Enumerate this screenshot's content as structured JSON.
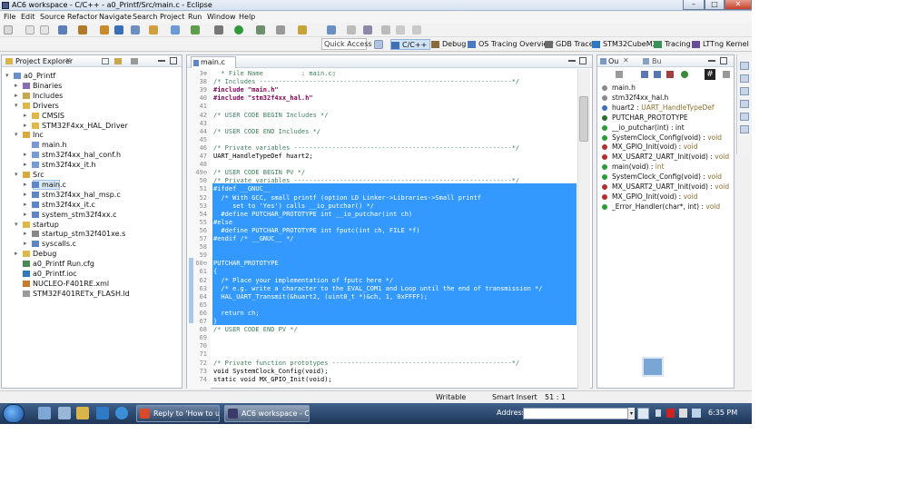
{
  "window": {
    "title": "AC6 workspace - C/C++ - a0_Printf/Src/main.c - Eclipse"
  },
  "menu": [
    "File",
    "Edit",
    "Source",
    "Refactor",
    "Navigate",
    "Search",
    "Project",
    "Run",
    "Window",
    "Help"
  ],
  "toolbar": {
    "quick_access": "Quick Access"
  },
  "perspectives": [
    "C/C++",
    "Debug",
    "OS Tracing Overview",
    "GDB Trace",
    "STM32CubeMX",
    "Tracing",
    "LTTng Kernel"
  ],
  "explorer": {
    "title": "Project Explorer",
    "items": [
      {
        "label": "a0_Printf",
        "depth": 0,
        "twisty": "▾",
        "icon": "project-icon"
      },
      {
        "label": "Binaries",
        "depth": 1,
        "twisty": "▸",
        "icon": "binaries-icon"
      },
      {
        "label": "Includes",
        "depth": 1,
        "twisty": "▸",
        "icon": "includes-icon"
      },
      {
        "label": "Drivers",
        "depth": 1,
        "twisty": "▾",
        "icon": "folder-icon"
      },
      {
        "label": "CMSIS",
        "depth": 2,
        "twisty": "▸",
        "icon": "folder-icon"
      },
      {
        "label": "STM32F4xx_HAL_Driver",
        "depth": 2,
        "twisty": "▸",
        "icon": "folder-icon"
      },
      {
        "label": "Inc",
        "depth": 1,
        "twisty": "▾",
        "icon": "source-folder-icon"
      },
      {
        "label": "main.h",
        "depth": 2,
        "twisty": "",
        "icon": "header-file-icon"
      },
      {
        "label": "stm32f4xx_hal_conf.h",
        "depth": 2,
        "twisty": "▸",
        "icon": "header-file-icon"
      },
      {
        "label": "stm32f4xx_it.h",
        "depth": 2,
        "twisty": "▸",
        "icon": "header-file-icon"
      },
      {
        "label": "Src",
        "depth": 1,
        "twisty": "▾",
        "icon": "source-folder-icon"
      },
      {
        "label": "main.c",
        "depth": 2,
        "twisty": "▸",
        "icon": "c-file-icon",
        "selected": true
      },
      {
        "label": "stm32f4xx_hal_msp.c",
        "depth": 2,
        "twisty": "▸",
        "icon": "c-file-icon"
      },
      {
        "label": "stm32f4xx_it.c",
        "depth": 2,
        "twisty": "▸",
        "icon": "c-file-icon"
      },
      {
        "label": "system_stm32f4xx.c",
        "depth": 2,
        "twisty": "▸",
        "icon": "c-file-icon"
      },
      {
        "label": "startup",
        "depth": 1,
        "twisty": "▾",
        "icon": "folder-icon"
      },
      {
        "label": "startup_stm32f401xe.s",
        "depth": 2,
        "twisty": "▸",
        "icon": "asm-file-icon"
      },
      {
        "label": "syscalls.c",
        "depth": 2,
        "twisty": "▸",
        "icon": "c-file-icon"
      },
      {
        "label": "Debug",
        "depth": 1,
        "twisty": "▸",
        "icon": "folder-icon"
      },
      {
        "label": "a0_Printf Run.cfg",
        "depth": 1,
        "twisty": "",
        "icon": "config-file-icon"
      },
      {
        "label": "a0_Printf.ioc",
        "depth": 1,
        "twisty": "",
        "icon": "ioc-file-icon"
      },
      {
        "label": "NUCLEO-F401RE.xml",
        "depth": 1,
        "twisty": "",
        "icon": "xml-file-icon"
      },
      {
        "label": "STM32F401RETx_FLASH.ld",
        "depth": 1,
        "twisty": "",
        "icon": "ld-file-icon"
      }
    ]
  },
  "editor": {
    "tab": "main.c",
    "lines": [
      {
        "n": "3⊕",
        "t": "  * File Name          : main.c▯",
        "k": "comment"
      },
      {
        "n": "38",
        "t": "/* Includes ------------------------------------------------------------------*/",
        "k": "comment"
      },
      {
        "n": "39",
        "t": "#include \"main.h\"",
        "k": "pre"
      },
      {
        "n": "40",
        "t": "#include \"stm32f4xx_hal.h\"",
        "k": "pre"
      },
      {
        "n": "41",
        "t": "",
        "k": "norm"
      },
      {
        "n": "42",
        "t": "/* USER CODE BEGIN Includes */",
        "k": "comment"
      },
      {
        "n": "43",
        "t": "",
        "k": "norm"
      },
      {
        "n": "44",
        "t": "/* USER CODE END Includes */",
        "k": "comment"
      },
      {
        "n": "45",
        "t": "",
        "k": "norm"
      },
      {
        "n": "46",
        "t": "/* Private variables ---------------------------------------------------------*/",
        "k": "comment"
      },
      {
        "n": "47",
        "t": "UART_HandleTypeDef huart2;",
        "k": "norm"
      },
      {
        "n": "48",
        "t": "",
        "k": "norm"
      },
      {
        "n": "49⊖",
        "t": "/* USER CODE BEGIN PV */",
        "k": "comment"
      },
      {
        "n": "50",
        "t": "/* Private variables ---------------------------------------------------------*/",
        "k": "comment"
      },
      {
        "n": "51",
        "t": "#ifdef __GNUC__",
        "k": "sel"
      },
      {
        "n": "52",
        "t": "  /* With GCC, small printf (option LD Linker->Libraries->Small printf",
        "k": "sel"
      },
      {
        "n": "53",
        "t": "     set to 'Yes') calls __io_putchar() */",
        "k": "sel"
      },
      {
        "n": "54",
        "t": "  #define PUTCHAR_PROTOTYPE int __io_putchar(int ch)",
        "k": "sel"
      },
      {
        "n": "55",
        "t": "#else",
        "k": "sel"
      },
      {
        "n": "56",
        "t": "  #define PUTCHAR_PROTOTYPE int fputc(int ch, FILE *f)",
        "k": "sel"
      },
      {
        "n": "57",
        "t": "#endif /* __GNUC__ */",
        "k": "sel"
      },
      {
        "n": "58",
        "t": "",
        "k": "sel"
      },
      {
        "n": "59",
        "t": "",
        "k": "sel"
      },
      {
        "n": "60⊖",
        "t": "PUTCHAR_PROTOTYPE",
        "k": "sel"
      },
      {
        "n": "61",
        "t": "{",
        "k": "sel"
      },
      {
        "n": "62",
        "t": "  /* Place your implementation of fputc here */",
        "k": "sel"
      },
      {
        "n": "63",
        "t": "  /* e.g. write a character to the EVAL_COM1 and Loop until the end of transmission */",
        "k": "sel"
      },
      {
        "n": "64",
        "t": "  HAL_UART_Transmit(&huart2, (uint8_t *)&ch, 1, 0xFFFF);",
        "k": "sel"
      },
      {
        "n": "65",
        "t": "",
        "k": "sel"
      },
      {
        "n": "66",
        "t": "  return ch;",
        "k": "sel"
      },
      {
        "n": "67",
        "t": "}",
        "k": "sel"
      },
      {
        "n": "68",
        "t": "/* USER CODE END PV */",
        "k": "comment"
      },
      {
        "n": "69",
        "t": "",
        "k": "norm"
      },
      {
        "n": "70",
        "t": "",
        "k": "norm"
      },
      {
        "n": "71",
        "t": "",
        "k": "norm"
      },
      {
        "n": "72",
        "t": "/* Private function prototypes -----------------------------------------------*/",
        "k": "comment"
      },
      {
        "n": "73",
        "t": "void SystemClock_Config(void);",
        "k": "norm"
      },
      {
        "n": "74",
        "t": "static void MX_GPIO_Init(void);",
        "k": "norm"
      }
    ]
  },
  "outline": {
    "tabs": [
      "Ou",
      "Bu"
    ],
    "items": [
      {
        "label": "main.h",
        "suffix": "",
        "icon": "include-icon",
        "color": "#8a8a8a"
      },
      {
        "label": "stm32f4xx_hal.h",
        "suffix": "",
        "icon": "include-icon",
        "color": "#8a8a8a"
      },
      {
        "label": "huart2 : ",
        "suffix": "UART_HandleTypeDef",
        "icon": "variable-icon",
        "color": "#3b6fb6"
      },
      {
        "label": "PUTCHAR_PROTOTYPE",
        "suffix": "",
        "icon": "macro-icon",
        "color": "#2b6d2b"
      },
      {
        "label": "__io_putchar(int) : int",
        "suffix": "",
        "icon": "function-icon",
        "color": "#2a9a3a"
      },
      {
        "label": "SystemClock_Config(void) : ",
        "suffix": "void",
        "icon": "function-icon",
        "color": "#2a9a3a"
      },
      {
        "label": "MX_GPIO_Init(void) : ",
        "suffix": "void",
        "icon": "static-function-icon",
        "color": "#b03030"
      },
      {
        "label": "MX_USART2_UART_Init(void) : ",
        "suffix": "void",
        "icon": "static-function-icon",
        "color": "#b03030"
      },
      {
        "label": "main(void) : ",
        "suffix": "int",
        "icon": "function-icon",
        "color": "#2a9a3a"
      },
      {
        "label": "SystemClock_Config(void) : ",
        "suffix": "void",
        "icon": "function-icon",
        "color": "#2a9a3a"
      },
      {
        "label": "MX_USART2_UART_Init(void) : ",
        "suffix": "void",
        "icon": "static-function-icon",
        "color": "#b03030"
      },
      {
        "label": "MX_GPIO_Init(void) : ",
        "suffix": "void",
        "icon": "static-function-icon",
        "color": "#b03030"
      },
      {
        "label": "_Error_Handler(char*, int) : ",
        "suffix": "void",
        "icon": "function-icon",
        "color": "#2a9a3a"
      }
    ]
  },
  "status": {
    "writable": "Writable",
    "insert_mode": "Smart Insert",
    "position": "51 : 1"
  },
  "taskbar": {
    "tasks": [
      "Reply to 'How to use...",
      "AC6 workspace - C/..."
    ],
    "address_label": "Address",
    "time": "6:35 PM"
  },
  "colors": {
    "selection": "#3399ff",
    "comment": "#3f7f5f",
    "keyword": "#7f0055",
    "taskbar": "#2b4a72"
  }
}
